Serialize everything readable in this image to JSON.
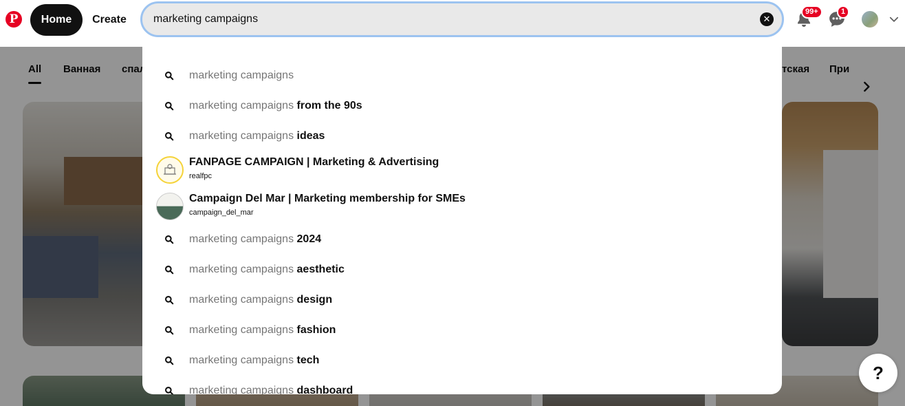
{
  "header": {
    "home_label": "Home",
    "create_label": "Create",
    "notifications_badge": "99+",
    "messages_badge": "1"
  },
  "search": {
    "value": "marketing campaigns",
    "clear_label": "✕"
  },
  "tabs": [
    {
      "label": "All"
    },
    {
      "label": "Ванная"
    },
    {
      "label": "спал"
    },
    {
      "label": "тская"
    },
    {
      "label": "При"
    }
  ],
  "suggestions": [
    {
      "base": "marketing campaigns",
      "rest": ""
    },
    {
      "base": "marketing campaigns",
      "rest": " from the 90s"
    },
    {
      "base": "marketing campaigns",
      "rest": " ideas"
    },
    {
      "base": "marketing campaigns",
      "rest": " 2024"
    },
    {
      "base": "marketing campaigns",
      "rest": " aesthetic"
    },
    {
      "base": "marketing campaigns",
      "rest": " design"
    },
    {
      "base": "marketing campaigns",
      "rest": " fashion"
    },
    {
      "base": "marketing campaigns",
      "rest": " tech"
    },
    {
      "base": "marketing campaigns",
      "rest": " dashboard"
    }
  ],
  "boards": [
    {
      "title": "FANPAGE CAMPAIGN | Marketing & Advertising",
      "owner": "realfpc"
    },
    {
      "title": "Campaign Del Mar | Marketing membership for SMEs",
      "owner": "campaign_del_mar"
    }
  ],
  "help": {
    "label": "?"
  },
  "colors": {
    "brand": "#e60023",
    "focus_ring": "#9cc3f0"
  },
  "icons": [
    "pinterest-logo-icon",
    "search-icon",
    "bell-icon",
    "chat-icon",
    "chevron-down-icon",
    "chevron-right-icon",
    "clear-icon"
  ]
}
